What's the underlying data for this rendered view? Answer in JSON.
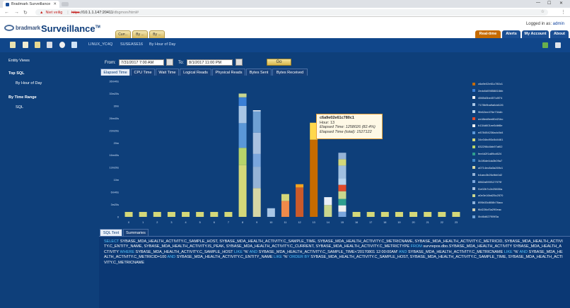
{
  "browser": {
    "tab_title": "Bradmark Surveillance",
    "address": {
      "not_secure": "Niet veilig",
      "scheme": "https",
      "host": "://10.1.1.147:20411",
      "path": "/dbgmon/html#"
    }
  },
  "header": {
    "brand": "bradmark",
    "app_title": "Surveillance",
    "trademark": "TM",
    "tabs": [
      "Curr...",
      "By ...",
      "By ..."
    ],
    "logged_in_label": "Logged in as:",
    "user": "admin",
    "right_tabs": [
      "Real-time",
      "Alerts",
      "My Account",
      "About"
    ]
  },
  "context": {
    "server": "LINUX_YC4Q",
    "instance": "SUSEASE16",
    "view": "By Hour of Day"
  },
  "sidebar": {
    "entity_views": "Entity Views",
    "top_sql": "Top SQL",
    "by_hour": "By Hour of Day",
    "by_time_range": "By Time Range",
    "sql": "SQL"
  },
  "filters": {
    "from_label": "From:",
    "from_value": "7/31/2017 7:00 AM",
    "to_label": "To:",
    "to_value": "8/1/2017 11:00 PM",
    "go_label": "Go"
  },
  "metric_tabs": [
    "Elapsed Time",
    "CPU Time",
    "Wait Time",
    "Logical Reads",
    "Physical Reads",
    "Bytes Sent",
    "Bytes Received"
  ],
  "bottom_tabs": [
    "SQL Text",
    "Summaries"
  ],
  "tooltip": {
    "title": "c6a9e02e61c780c1",
    "hour": "Hour: 13",
    "elapsed": "Elapsed Time: 1258026 (82.4%)",
    "elapsed_total": "Elapsed Time (total): 1527122"
  },
  "colors": {
    "accent_orange": "#c66b00",
    "panel_bg": "#0e3f7a"
  },
  "chart_data": {
    "type": "bar",
    "stacked": true,
    "xlabel": "",
    "ylabel": "",
    "categories": [
      "0",
      "1",
      "2",
      "3",
      "4",
      "5",
      "6",
      "7",
      "8",
      "9",
      "10",
      "11",
      "12",
      "13",
      "14",
      "15",
      "16",
      "17",
      "18",
      "19",
      "20",
      "21",
      "22",
      "23"
    ],
    "ytick_labels": [
      "0",
      "3m20s",
      "6m40s",
      "10m",
      "13m20s",
      "16m40s",
      "20m",
      "23m20s",
      "26m40s",
      "30m",
      "33m20s",
      "36m40s"
    ],
    "ylim_seconds": [
      0,
      2200
    ],
    "totals_seconds": [
      80,
      80,
      80,
      80,
      80,
      80,
      80,
      80,
      2000,
      1730,
      140,
      370,
      530,
      1527,
      320,
      1040,
      80,
      80,
      80,
      80,
      80,
      80,
      80,
      80
    ],
    "legend": [
      "c6a9e02e61c780c1",
      "2edc6d09858816bb",
      "4565d3be457c8f74",
      "7178b9ba9a6dd126",
      "9fe62ee476e734db",
      "ee48ed8ee80d21bc",
      "b134d601ee5dbf8e",
      "e878454236adc0d4",
      "34e34bd93c5d4461",
      "832298d4bb97af02",
      "fee4d2f1a89cd624",
      "3c1f6de4da3b09a7",
      "a0714ec8a3a269c1",
      "b4aec3b26cfbb0d2",
      "8862a590f127979f",
      "f1e02b7c2e25830a",
      "a0e3e16bd25c2570",
      "895b33d808b76acc",
      "f6d226cf3a290eac",
      "0b46d627f09f3a"
    ],
    "legend_colors": [
      "#c66b00",
      "#3a7fd6",
      "#f2f2f2",
      "#a8c6e6",
      "#b8d4ee",
      "#e04a2a",
      "#f0f0f0",
      "#5a97d8",
      "#d4d879",
      "#b7d36a",
      "#2e9e8e",
      "#3f86c8",
      "#d7d7a5",
      "#95b3d6",
      "#7aa6dd",
      "#a9c1e0",
      "#c9d68e",
      "#8cb0d9",
      "#d0d0b0",
      "#6fa0d3"
    ],
    "highlight": {
      "category": "13",
      "series": "c6a9e02e61c780c1",
      "value": 1258026
    }
  },
  "sql": {
    "p1": "SELECT",
    "p2": "SYBASE_MDA_HEALTH_ACTIVITY.C_SAMPLE_HOST, SYBASE_MDA_HEALTH_ACTIVITY.C_SAMPLE_TIME, SYBASE_MDA_HEALTH_ACTIVITY.C_METRICNAME, SYBASE_MDA_HEALTH_ACTIVITY.C_METRICID, SYBASE_MDA_HEALTH_ACTIVITY.C_ENTITY_NAME, SYBASE_MDA_HEALTH_ACTIVITY.IS_PEAK, SYBASE_MDA_HEALTH_ACTIVITY.C_CURRENT, SYBASE_MDA_HEALTH_ACTIVITY.C_METRICTYPE",
    "p3": "FROM",
    "p4": "survrepos.dbo.SYBASE_MDA_HEALTH_ACTIVITY SYBASE_MDA_HEALTH_ACTIVITY",
    "p5": "WHERE",
    "p6": "SYBASE_MDA_HEALTH_ACTIVITY.C_SAMPLE_HOST",
    "p7": "LIKE",
    "p8": "'%'",
    "p9": "AND",
    "p10": "SYBASE_MDA_HEALTH_ACTIVITY.C_SAMPLE_TIME<'20170801 12:00:00AM'",
    "p11": "AND",
    "p12": "SYBASE_MDA_HEALTH_ACTIVITY.C_METRICNAME",
    "p13": "LIKE",
    "p14": "'%'",
    "p15": "AND",
    "p16": "SYBASE_MDA_HEALTH_ACTIVITY.C_METRICID=100",
    "p17": "AND",
    "p18": "SYBASE_MDA_HEALTH_ACTIVITY.C_ENTITY_NAME",
    "p19": "LIKE",
    "p20": "'%'",
    "p21": "ORDER BY",
    "p22": "SYBASE_MDA_HEALTH_ACTIVITY.C_SAMPLE_HOST, SYBASE_MDA_HEALTH_ACTIVITY.C_SAMPLE_TIME, SYBASE_MDA_HEALTH_ACTIVITY.C_METRICNAME"
  }
}
